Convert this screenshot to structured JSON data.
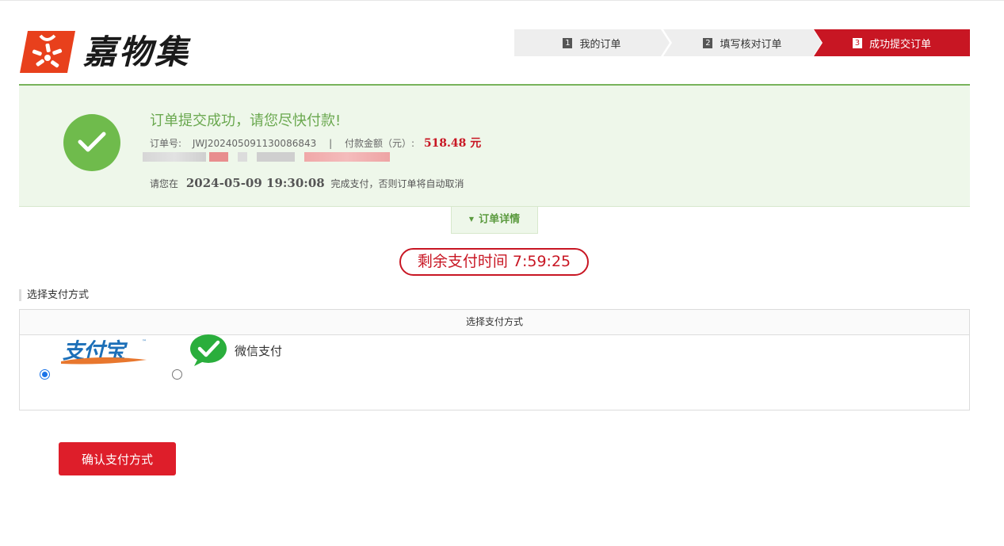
{
  "logo": {
    "text": "嘉物集",
    "icon": "logo-icon"
  },
  "steps": [
    {
      "num": "1",
      "label": "我的订单"
    },
    {
      "num": "2",
      "label": "填写核对订单"
    },
    {
      "num": "3",
      "label": "成功提交订单"
    }
  ],
  "success": {
    "title": "订单提交成功，请您尽快付款!",
    "order_label": "订单号:",
    "order_no": "JWJ2024050911300868​43",
    "separator": "|",
    "amount_label": "付款金额（元）:",
    "amount": "518.48 元",
    "deadline_prefix": "请您在",
    "deadline": "2024-05-09 19:30:08",
    "deadline_suffix": "完成支付，否则订单将自动取消"
  },
  "detail_tab": {
    "label": "订单详情",
    "icon": "caret-down-icon"
  },
  "countdown": {
    "text": "剩余支付时间 7:59:25"
  },
  "payment": {
    "section_title": "选择支付方式",
    "table_header": "选择支付方式",
    "options": [
      {
        "name": "支付宝",
        "selected": true,
        "icon": "alipay-logo"
      },
      {
        "name": "微信支付",
        "selected": false,
        "icon": "wechat-pay-icon"
      }
    ]
  },
  "confirm_button": "确认支付方式",
  "colors": {
    "brand_red": "#c81623",
    "success_green": "#6fbb4c",
    "success_bg": "#eef7ea",
    "button_red": "#de1e2a"
  }
}
